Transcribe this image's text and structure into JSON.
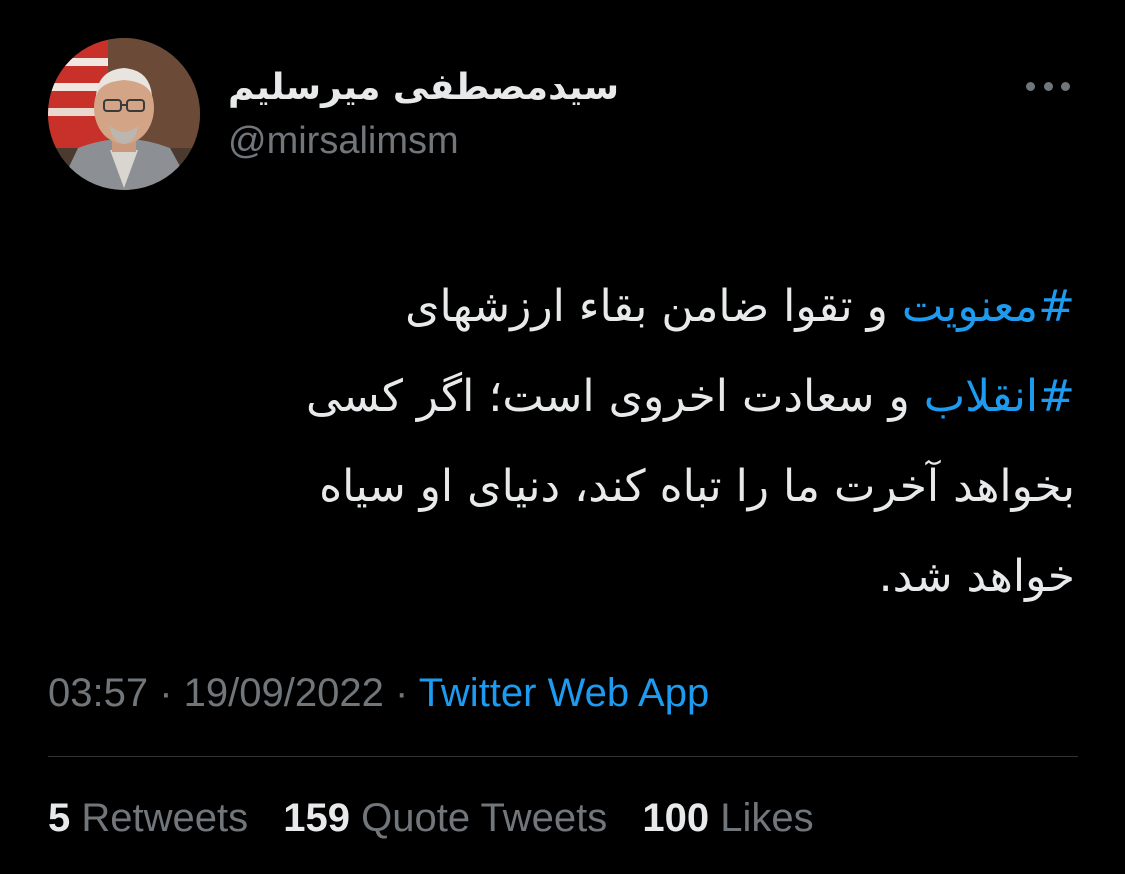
{
  "author": {
    "display_name": "سیدمصطفی میرسلیم",
    "handle": "@mirsalimsm"
  },
  "tweet": {
    "lines": [
      [
        {
          "text": "#معنویت",
          "hashtag": true
        },
        {
          "text": " و تقوا ضامن بقاء ارزشهای",
          "hashtag": false
        }
      ],
      [
        {
          "text": "#انقلاب",
          "hashtag": true
        },
        {
          "text": " و سعادت اخروی است؛ اگر کسی",
          "hashtag": false
        }
      ],
      [
        {
          "text": "بخواهد آخرت ما را تباه کند، دنیای او سیاه",
          "hashtag": false
        }
      ],
      [
        {
          "text": "خواهد شد.",
          "hashtag": false
        }
      ]
    ]
  },
  "meta": {
    "time": "03:57",
    "separator": " · ",
    "date": "19/09/2022",
    "separator2": " · ",
    "source": "Twitter Web App"
  },
  "stats": {
    "retweets_count": "5",
    "retweets_label": "Retweets",
    "quotes_count": "159",
    "quotes_label": "Quote Tweets",
    "likes_count": "100",
    "likes_label": "Likes"
  },
  "colors": {
    "background": "#000000",
    "text": "#e7e9ea",
    "secondary": "#71767b",
    "accent": "#1d9bf0"
  },
  "icons": {
    "more": "more-horizontal-icon"
  }
}
